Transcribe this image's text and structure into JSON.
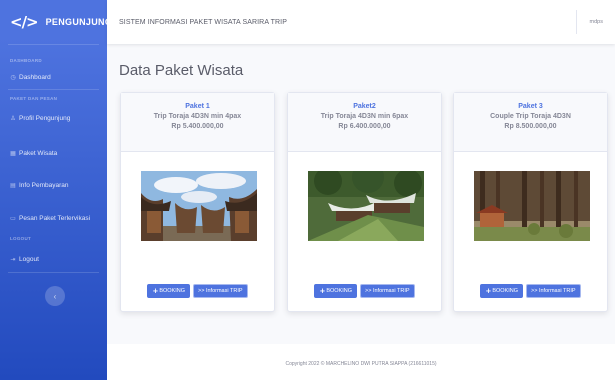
{
  "brand": {
    "logo": "</>",
    "name": "PENGUNJUNG"
  },
  "sidebar": {
    "heading_dashboard": "DASHBOARD",
    "heading_pages": "PAKET DAN PESAN",
    "heading_logout": "LOGOUT",
    "items": [
      {
        "label": "Dashboard",
        "icon": "dashboard-icon"
      },
      {
        "label": "Profil Pengunjung",
        "icon": "user-icon"
      },
      {
        "label": "Paket Wisata",
        "icon": "table-icon"
      },
      {
        "label": "Info Pembayaran",
        "icon": "table-icon"
      },
      {
        "label": "Pesan Paket Terlervikasi",
        "icon": "chat-icon"
      },
      {
        "label": "Logout",
        "icon": "signout-icon"
      }
    ],
    "toggle": "‹"
  },
  "topbar": {
    "title": "SISTEM INFORMASI PAKET WISATA SARIRA TRIP",
    "user": "mdps"
  },
  "page": {
    "title": "Data Paket Wisata"
  },
  "cards": [
    {
      "name": "Paket 1",
      "subtitle": "Trip Toraja 4D3N min 4pax",
      "price": "Rp 5.400.000,00",
      "book_label": "BOOKING",
      "info_label": ">> Informasi TRIP"
    },
    {
      "name": "Paket2",
      "subtitle": "Trip Toraja 4D3N min 6pax",
      "price": "Rp 6.400.000,00",
      "book_label": "BOOKING",
      "info_label": ">> Informasi TRIP"
    },
    {
      "name": "Paket 3",
      "subtitle": "Couple Trip Toraja 4D3N",
      "price": "Rp 8.500.000,00",
      "book_label": "BOOKING",
      "info_label": ">> Informasi TRIP"
    }
  ],
  "footer": {
    "text": "Copyright 2022 © MARCHELINO DWI PUTRA SIAPPA (216611015)"
  },
  "colors": {
    "primary": "#4e73df",
    "sidebar_dark": "#224abe",
    "text": "#5a5c69"
  }
}
